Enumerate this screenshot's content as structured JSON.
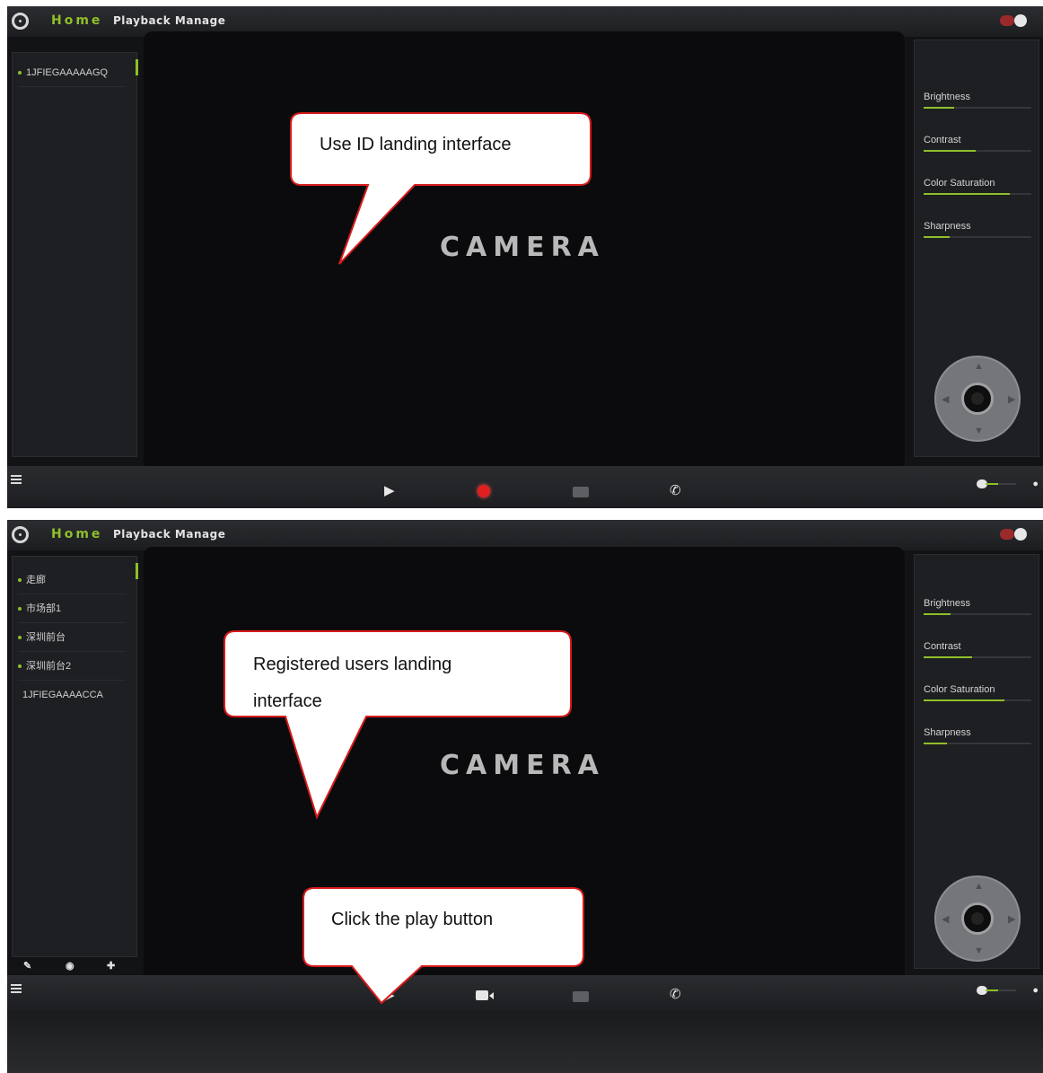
{
  "app": {
    "home_label": "Home",
    "playback_manage_label": "Playback Manage",
    "camera_logo": "CAMERA",
    "accent_color": "#8fbf2a"
  },
  "screens": [
    {
      "devices": [
        {
          "label": "1JFIEGAAAAAGQ",
          "online": true
        }
      ],
      "adjustments": [
        {
          "label": "Brightness",
          "level": 0.28
        },
        {
          "label": "Contrast",
          "level": 0.48
        },
        {
          "label": "Color Saturation",
          "level": 0.8
        },
        {
          "label": "Sharpness",
          "level": 0.24
        }
      ],
      "bottom_controls": [
        "play-icon",
        "record-icon",
        "snapshot-icon",
        "phone-icon"
      ],
      "callout": "Use ID landing interface"
    },
    {
      "devices": [
        {
          "label": "走廊",
          "online": true
        },
        {
          "label": "市场部1",
          "online": true
        },
        {
          "label": "深圳前台",
          "online": true
        },
        {
          "label": "深圳前台2",
          "online": true
        },
        {
          "label": "1JFIEGAAAACCA",
          "online": false
        }
      ],
      "adjustments": [
        {
          "label": "Brightness",
          "level": 0.25
        },
        {
          "label": "Contrast",
          "level": 0.45
        },
        {
          "label": "Color Saturation",
          "level": 0.75
        },
        {
          "label": "Sharpness",
          "level": 0.22
        }
      ],
      "left_tools": [
        "wrench-icon",
        "zoom-icon",
        "add-icon"
      ],
      "bottom_controls": [
        "play-icon",
        "video-camera-icon",
        "snapshot-icon",
        "phone-icon"
      ],
      "callouts": [
        "Registered users landing",
        "interface",
        "Click the play button"
      ]
    }
  ]
}
